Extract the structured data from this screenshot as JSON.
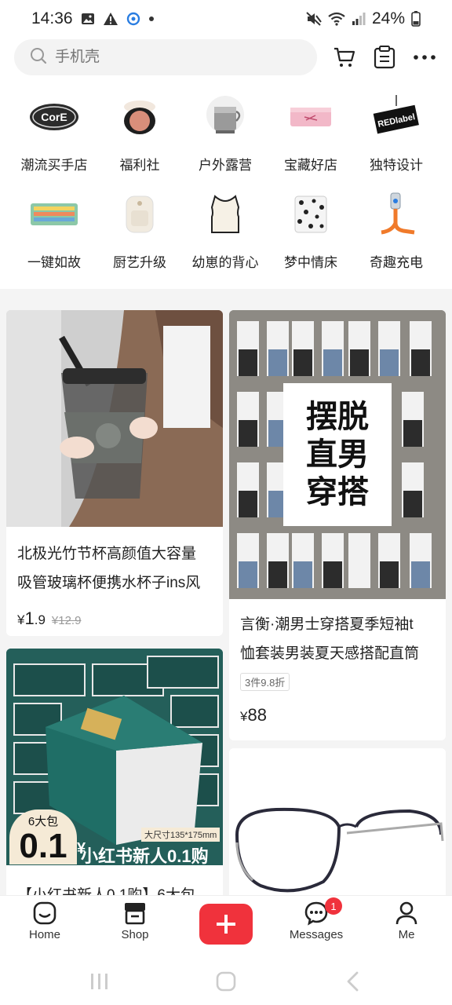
{
  "status_bar": {
    "time": "14:36",
    "battery": "24%"
  },
  "search": {
    "placeholder": "手机壳"
  },
  "categories": [
    {
      "label": "潮流买手店"
    },
    {
      "label": "福利社"
    },
    {
      "label": "户外露营"
    },
    {
      "label": "宝藏好店"
    },
    {
      "label": "独特设计"
    },
    {
      "label": "一键如故"
    },
    {
      "label": "厨艺升级"
    },
    {
      "label": "幼崽的背心"
    },
    {
      "label": "梦中情床"
    },
    {
      "label": "奇趣充电"
    }
  ],
  "category_thumb_text": {
    "core": "CorE",
    "redlabel": "REDlabel"
  },
  "products": [
    {
      "title_line1": "北极光竹节杯高颜值大容量",
      "title_line2": "吸管玻璃杯便携水杯子ins风",
      "price_symbol": "¥",
      "price_int": "1",
      "price_dec": ".9",
      "price_old": "¥12.9"
    },
    {
      "overlay_line1": "摆脱",
      "overlay_line2": "直男",
      "overlay_line3": "穿搭",
      "title_line1": "言衡·潮男士穿搭夏季短袖t",
      "title_line2": "恤套装男装夏天感搭配直筒",
      "tag": "3件9.8折",
      "price_symbol": "¥",
      "price": "88"
    },
    {
      "badge_top": "6大包",
      "badge_price": "0.1",
      "badge_sym": "¥",
      "banner": "小红书新人0.1购",
      "size_text": "大尺寸135*175mm",
      "title_line1": "【小红书新人0.1购】6大包"
    },
    {
      "image": "eyeglasses"
    }
  ],
  "bottom_nav": {
    "home": "Home",
    "shop": "Shop",
    "messages": "Messages",
    "messages_badge": "1",
    "me": "Me"
  },
  "colors": {
    "accent": "#f0323c",
    "feed_bg": "#f4f4f4"
  }
}
